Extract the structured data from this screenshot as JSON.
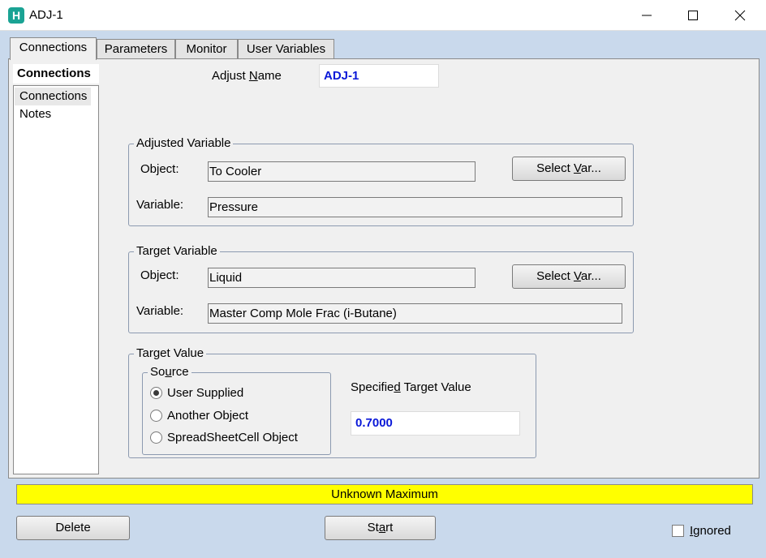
{
  "window": {
    "title": "ADJ-1",
    "icon_glyph": "H",
    "controls": [
      "minimize-icon",
      "maximize-icon",
      "close-icon"
    ]
  },
  "tabs": [
    {
      "label": "Connections",
      "active": true
    },
    {
      "label": "Parameters",
      "active": false
    },
    {
      "label": "Monitor",
      "active": false
    },
    {
      "label": "User Variables",
      "active": false
    }
  ],
  "nav": {
    "header": "Connections",
    "items": [
      {
        "label": "Connections",
        "selected": true
      },
      {
        "label": "Notes",
        "selected": false
      }
    ]
  },
  "adjust_name": {
    "label_pre": "Adjust ",
    "label_hotkey": "N",
    "label_post": "ame",
    "value": "ADJ-1"
  },
  "adjusted_variable": {
    "title": "Adjusted Variable",
    "object_label": "Object:",
    "object_value": "To Cooler",
    "variable_label": "Variable:",
    "variable_value": "Pressure",
    "select_pre": "Select ",
    "select_hotkey": "V",
    "select_post": "ar..."
  },
  "target_variable": {
    "title": "Target Variable",
    "object_label": "Object:",
    "object_value": "Liquid",
    "variable_label": "Variable:",
    "variable_value": "Master Comp Mole Frac (i-Butane)",
    "select_pre": "Select ",
    "select_hotkey": "V",
    "select_post": "ar..."
  },
  "target_value": {
    "title": "Target Value",
    "source": {
      "title_pre": "So",
      "title_hotkey": "u",
      "title_post": "rce",
      "options": [
        {
          "label": "User Supplied",
          "checked": true
        },
        {
          "label": "Another Object",
          "checked": false
        },
        {
          "label": "SpreadSheetCell Object",
          "checked": false
        }
      ]
    },
    "specified_label_pre": "Specifie",
    "specified_label_hotkey": "d",
    "specified_label_post": " Target Value",
    "specified_value": "0.7000"
  },
  "status": {
    "text": "Unknown Maximum",
    "color": "#ffff00"
  },
  "footer": {
    "delete_label": "Delete",
    "start_pre": "St",
    "start_hotkey": "a",
    "start_post": "rt",
    "ignored_hotkey": "I",
    "ignored_post": "gnored",
    "ignored_checked": false
  },
  "colors": {
    "accent_text": "#0a18d8",
    "client_background": "#c9d9ec",
    "app_icon": "#1aa394"
  }
}
